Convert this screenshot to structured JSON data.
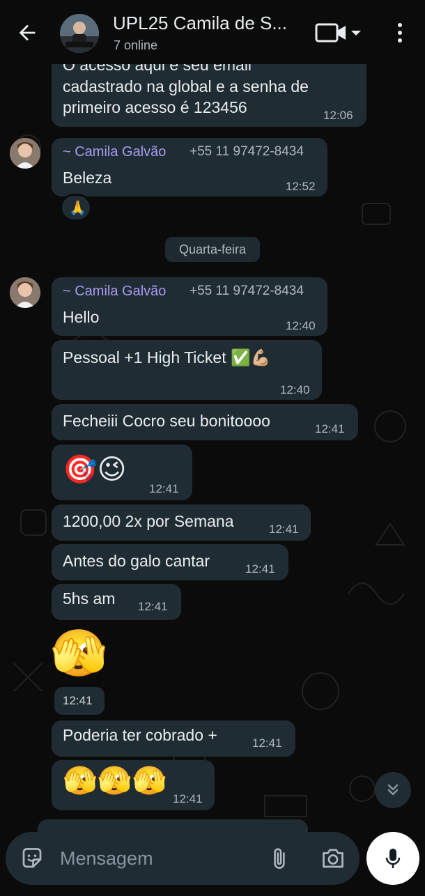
{
  "header": {
    "title": "UPL25 Camila de S...",
    "subtitle": "7 online"
  },
  "messages": {
    "m1": {
      "text_line1": "O acesso aqui é seu email",
      "text_line2": "cadastrado na global e a senha de",
      "text_line3": "primeiro acesso é 123456",
      "time": "12:06"
    },
    "m2": {
      "sender": "~ Camila Galvão",
      "phone": "+55 11 97472-8434",
      "text": "Beleza",
      "time": "12:52",
      "reaction": "🙏"
    },
    "date_separator": "Quarta-feira",
    "m3": {
      "sender": "~ Camila Galvão",
      "phone": "+55 11 97472-8434",
      "text": "Hello",
      "time": "12:40"
    },
    "m4": {
      "text": "Pessoal +1  High Ticket ✅💪🏼",
      "time": "12:40"
    },
    "m5": {
      "text": "Fecheiii Cocro seu bonitoooo",
      "time": "12:41"
    },
    "m6": {
      "text": "🎯😉",
      "time": "12:41"
    },
    "m7": {
      "text": "1200,00 2x por Semana",
      "time": "12:41"
    },
    "m8": {
      "text": "Antes do galo cantar",
      "time": "12:41"
    },
    "m9": {
      "text": "5hs am",
      "time": "12:41"
    },
    "m10": {
      "text": "🫣",
      "time": "12:41"
    },
    "m11": {
      "text": "Poderia ter cobrado +",
      "time": "12:41"
    },
    "m12": {
      "text": "🫣🫣🫣",
      "time": "12:41"
    }
  },
  "input": {
    "placeholder": "Mensagem"
  },
  "icons": {
    "back": "arrow-left-icon",
    "video": "video-call-icon",
    "more": "more-vertical-icon",
    "sticker": "sticker-icon",
    "attach": "paperclip-icon",
    "camera": "camera-icon",
    "mic": "microphone-icon",
    "scroll": "double-chevron-down-icon"
  },
  "colors": {
    "background": "#0b0b0b",
    "bubble": "#202c33",
    "sender_name": "#a89bf3",
    "meta_text": "#aeb8bf",
    "mic_button": "#ffffff"
  }
}
